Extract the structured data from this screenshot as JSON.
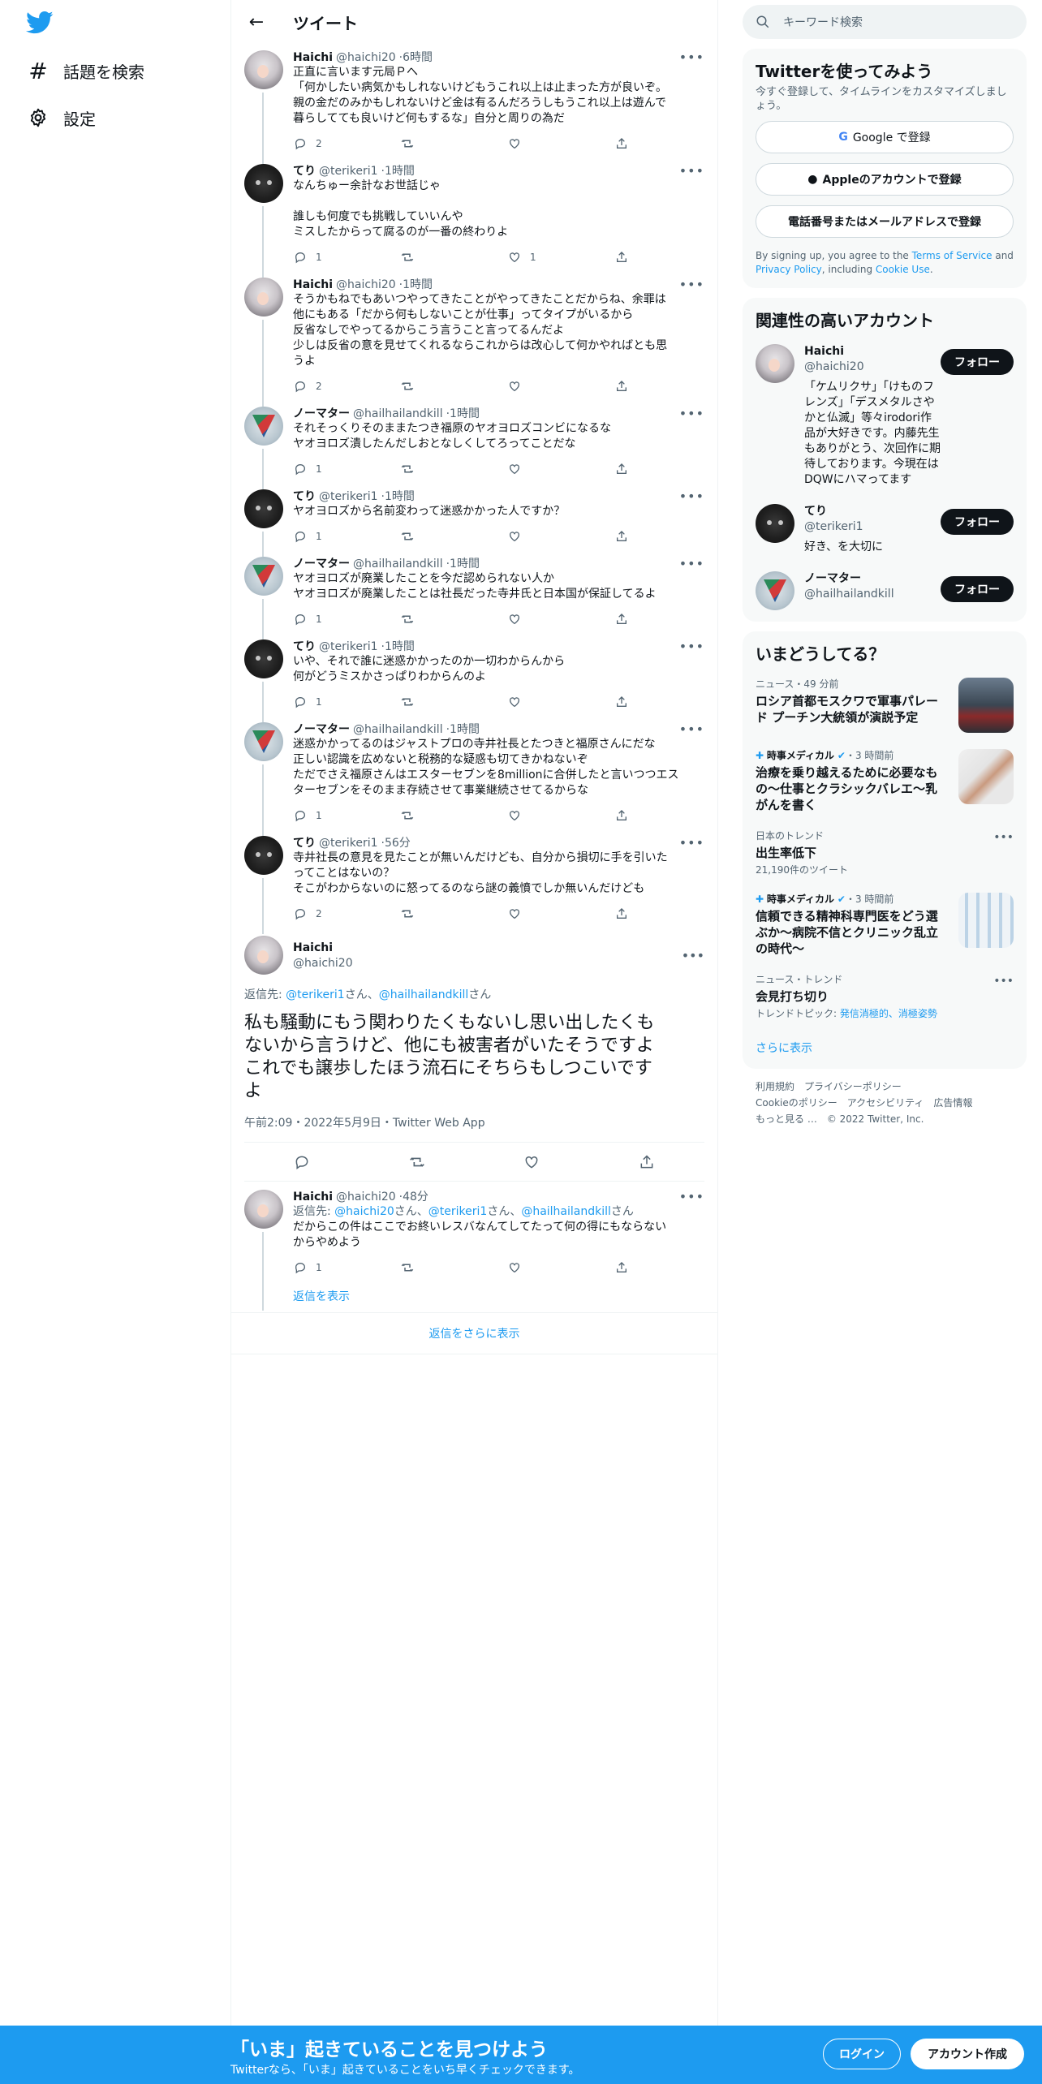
{
  "nav": {
    "explore": "話題を検索",
    "settings": "設定"
  },
  "header": {
    "title": "ツイート"
  },
  "thread": [
    {
      "name": "Haichi",
      "handle": "@haichi20",
      "time": "6時間",
      "avatar": "A",
      "text": "正直に言います元局Ｐへ\n「何かしたい病気かもしれないけどもうこれ以上は止まった方が良いぞ。\n親の金だのみかもしれないけど金は有るんだろうしもうこれ以上は遊んで\n暮らしてても良いけど何もするな」自分と周りの為だ",
      "replies": "2",
      "retweets": "",
      "likes": ""
    },
    {
      "name": "てり",
      "handle": "@terikeri1",
      "time": "1時間",
      "avatar": "T",
      "text": "なんちゅー余計なお世話じゃ\n\n誰しも何度でも挑戦していいんや\nミスしたからって腐るのが一番の終わりよ",
      "replies": "1",
      "retweets": "",
      "likes": "1"
    },
    {
      "name": "Haichi",
      "handle": "@haichi20",
      "time": "1時間",
      "avatar": "A",
      "text": "そうかもねでもあいつやってきたことがやってきたことだからね、余罪は\n他にもある「だから何もしないことが仕事」ってタイプがいるから\n反省なしでやってるからこう言うこと言ってるんだよ\n少しは反省の意を見せてくれるならこれからは改心して何かやればとも思\nうよ",
      "replies": "2",
      "retweets": "",
      "likes": ""
    },
    {
      "name": "ノーマター",
      "handle": "@hailhailandkill",
      "time": "1時間",
      "avatar": "N",
      "text": "それそっくりそのままたつき福原のヤオヨロズコンビになるな\nヤオヨロズ潰したんだしおとなしくしてろってことだな",
      "replies": "1",
      "retweets": "",
      "likes": ""
    },
    {
      "name": "てり",
      "handle": "@terikeri1",
      "time": "1時間",
      "avatar": "T",
      "text": "ヤオヨロズから名前変わって迷惑かかった人ですか？",
      "replies": "1",
      "retweets": "",
      "likes": ""
    },
    {
      "name": "ノーマター",
      "handle": "@hailhailandkill",
      "time": "1時間",
      "avatar": "N",
      "text": "ヤオヨロズが廃業したことを今だ認められない人か\nヤオヨロズが廃業したことは社長だった寺井氏と日本国が保証してるよ",
      "replies": "1",
      "retweets": "",
      "likes": ""
    },
    {
      "name": "てり",
      "handle": "@terikeri1",
      "time": "1時間",
      "avatar": "T",
      "text": "いや、それで誰に迷惑かかったのか一切わからんから\n何がどうミスかさっぱりわからんのよ",
      "replies": "1",
      "retweets": "",
      "likes": ""
    },
    {
      "name": "ノーマター",
      "handle": "@hailhailandkill",
      "time": "1時間",
      "avatar": "N",
      "text": "迷惑かかってるのはジャストプロの寺井社長とたつきと福原さんにだな\n正しい認識を広めないと税務的な疑惑も切てきかねないぞ\nただでさえ福原さんはエスターセブンを8millionに合併したと言いつつエス\nターセブンをそのまま存続させて事業継続させてるからな",
      "replies": "1",
      "retweets": "",
      "likes": ""
    },
    {
      "name": "てり",
      "handle": "@terikeri1",
      "time": "56分",
      "avatar": "T",
      "text": "寺井社長の意見を見たことが無いんだけども、自分から損切に手を引いた\nってことはないの？\nそこがわからないのに怒ってるのなら謎の義憤でしか無いんだけども",
      "replies": "2",
      "retweets": "",
      "likes": ""
    }
  ],
  "main_tweet": {
    "name": "Haichi",
    "handle": "@haichi20",
    "reply_label": "返信先: ",
    "reply_to_1": "@terikeri1",
    "reply_sep_1": "さん、",
    "reply_to_2": "@hailhailandkill",
    "reply_sep_2": "さん",
    "text": "私も騒動にもう関わりたくもないし思い出したくも\nないから言うけど、他にも被害者がいたそうですよ\nこれでも譲歩したほう流石にそちらもしつこいです\nよ",
    "meta": "午前2:09・2022年5月9日・Twitter Web App"
  },
  "reply": {
    "name": "Haichi",
    "handle": "@haichi20",
    "time": "48分",
    "reply_label": "返信先: ",
    "reply_to_1": "@haichi20",
    "reply_to_2": "@terikeri1",
    "reply_to_3": "@hailhailandkill",
    "san_comma": "さん、",
    "san": "さん",
    "text": "だからこの件はここでお終いレスバなんてしてたって何の得にもならない\nからやめよう",
    "replies": "1",
    "show_replies": "返信を表示"
  },
  "more_replies": "返信をさらに表示",
  "search": {
    "placeholder": "キーワード検索"
  },
  "signup": {
    "title": "Twitterを使ってみよう",
    "subtitle": "今すぐ登録して、タイムラインをカスタマイズしましょう。",
    "google": "Google で登録",
    "apple": "Appleのアカウントで登録",
    "phone": "電話番号またはメールアドレスで登録",
    "terms_1": "By signing up, you agree to the ",
    "terms_tos": "Terms of Service",
    "terms_2": " and ",
    "terms_privacy": "Privacy Policy",
    "terms_3": ", including ",
    "terms_cookie": "Cookie Use",
    "terms_4": "."
  },
  "relevant": {
    "title": "関連性の高いアカウント",
    "follow": "フォロー",
    "accounts": [
      {
        "name": "Haichi",
        "handle": "@haichi20",
        "bio": "「ケムリクサ」「けものフレンズ」「デスメタルさやかと仏滅」等々irodori作品が大好きです。内藤先生もありがとう、次回作に期待しております。今現在はDQWにハマってます"
      },
      {
        "name": "てり",
        "handle": "@terikeri1",
        "bio": "好き、を大切に"
      },
      {
        "name": "ノーマター",
        "handle": "@hailhailandkill",
        "bio": ""
      }
    ]
  },
  "trends": {
    "title": "いまどうしてる？",
    "items": [
      {
        "meta": "ニュース・49 分前",
        "title": "ロシア首都モスクワで軍事パレード プーチン大統領が演説予定",
        "sub": ""
      },
      {
        "meta_src": "時事メディカル",
        "meta": "・3 時間前",
        "title": "治療を乗り越えるために必要なもの～仕事とクラシックバレエ～乳がんを書く",
        "sub": ""
      },
      {
        "meta": "日本のトレンド",
        "title": "出生率低下",
        "sub": "21,190件のツイート"
      },
      {
        "meta_src": "時事メディカル",
        "meta": "・3 時間前",
        "title": "信頼できる精神科専門医をどう選ぶか～病院不信とクリニック乱立の時代～",
        "sub": ""
      },
      {
        "meta": "ニュース・トレンド",
        "title": "会見打ち切り",
        "sub_label": "トレンドトピック: ",
        "sub_links": "発信消極的、消極姿勢"
      }
    ],
    "show_more": "さらに表示"
  },
  "footer": {
    "terms": "利用規約",
    "privacy": "プライバシーポリシー",
    "cookie": "Cookieのポリシー",
    "accessibility": "アクセシビリティ",
    "ads": "広告情報",
    "more": "もっと見る …",
    "copyright": "© 2022 Twitter, Inc."
  },
  "bottom": {
    "title": "「いま」起きていることを見つけよう",
    "subtitle": "Twitterなら、「いま」起きていることをいち早くチェックできます。",
    "login": "ログイン",
    "signup": "アカウント作成"
  },
  "colors": {
    "accent": "#1d9bf0",
    "text": "#0f1419",
    "muted": "#536471"
  }
}
